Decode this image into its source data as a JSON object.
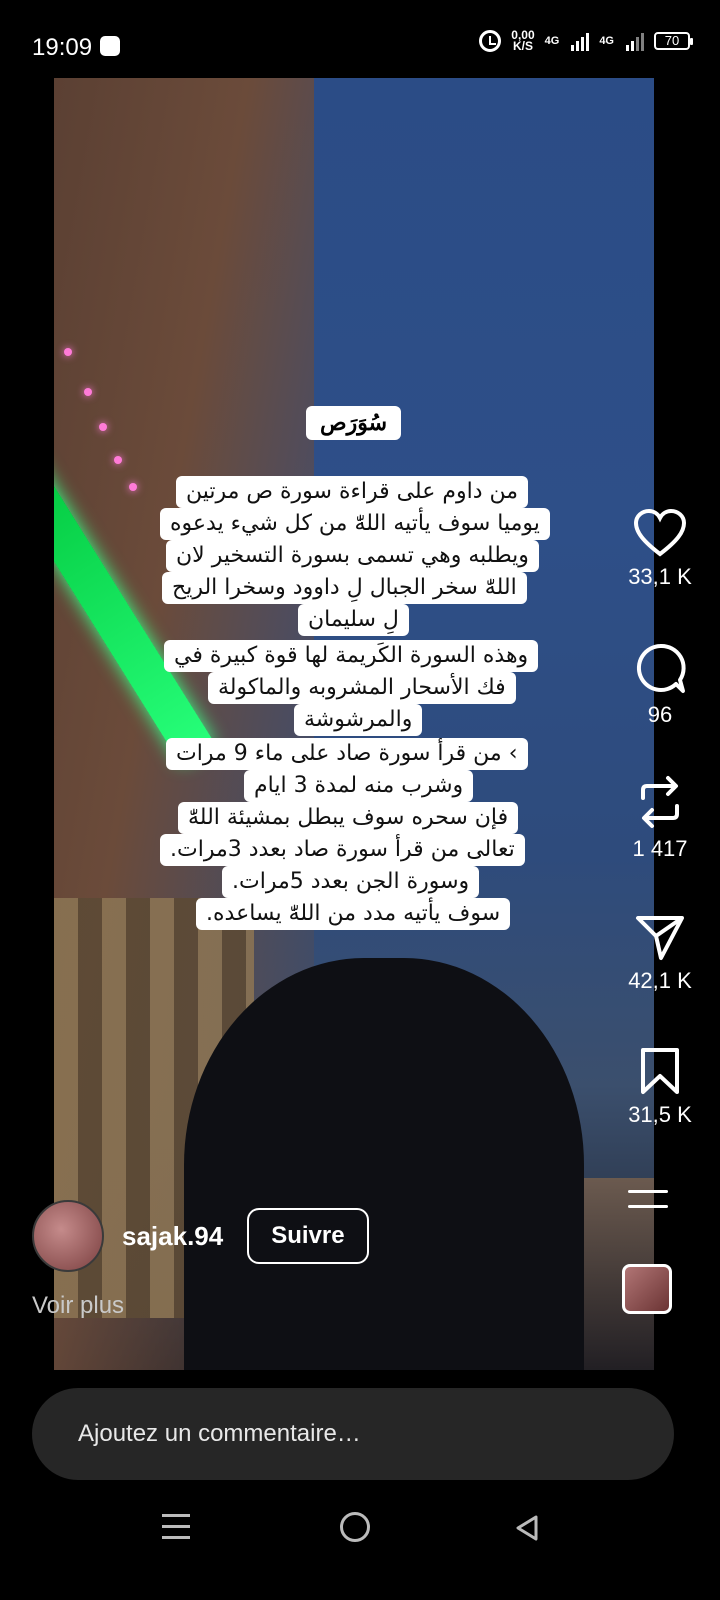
{
  "status": {
    "time": "19:09",
    "speed_top": "0,00",
    "speed_bottom": "K/S",
    "net1": "4G",
    "net2": "4G",
    "battery": "70"
  },
  "video": {
    "title": "سُوَرَص",
    "lines": [
      "من داوم على قراءة سورة ص مرتين",
      "يوميا سوف يأتيه اللهّٰ من كل شيء يدعوه",
      "ويطلبه وهي تسمى بسورة التسخير لان",
      "اللهّٰ سخر الجبال لِ داوود وسخرا الريح",
      "لِ سليمان",
      "وهذه السورة الكَريمة لها قوة كبيرة في",
      "فك الأسحار المشروبه والماكولة",
      "والمرشوشة",
      "› من قرأ سورة صاد على ماء 9 مرات",
      "وشرب منه لمدة 3 ايام",
      "فإن سحره سوف يبطل بمشيئة اللهّٰ",
      "تعالى من قرأ سورة صاد بعدد 3مرات.",
      "وسورة الجن بعدد 5مرات.",
      "سوف يأتيه مدد من اللهّٰ يساعده."
    ]
  },
  "actions": {
    "likes": "33,1 K",
    "comments": "96",
    "reposts": "1 417",
    "shares": "42,1 K",
    "saves": "31,5 K"
  },
  "profile": {
    "username": "sajak.94",
    "follow_label": "Suivre",
    "see_more": "Voir plus"
  },
  "comment": {
    "placeholder": "Ajoutez un commentaire…"
  }
}
